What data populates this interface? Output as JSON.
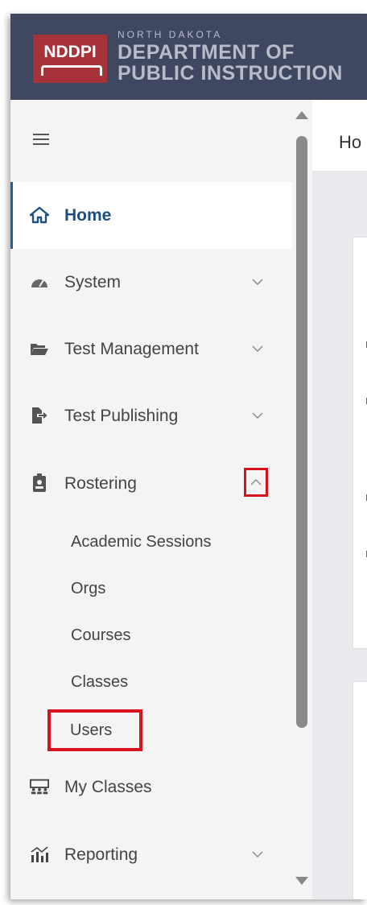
{
  "header": {
    "badge": "NDDPI",
    "org_small": "NORTH DAKOTA",
    "org_line1": "DEPARTMENT OF",
    "org_line2": "PUBLIC INSTRUCTION"
  },
  "sidebar": {
    "items": [
      {
        "label": "Home",
        "icon": "home-icon"
      },
      {
        "label": "System",
        "icon": "gauge-icon"
      },
      {
        "label": "Test Management",
        "icon": "folder-icon"
      },
      {
        "label": "Test Publishing",
        "icon": "file-export-icon"
      },
      {
        "label": "Rostering",
        "icon": "id-badge-icon"
      },
      {
        "label": "My Classes",
        "icon": "classroom-icon"
      },
      {
        "label": "Reporting",
        "icon": "chart-icon"
      }
    ],
    "rostering_sub": [
      "Academic Sessions",
      "Orgs",
      "Courses",
      "Classes",
      "Users"
    ]
  },
  "content": {
    "title": "Ho"
  },
  "colors": {
    "header_bg": "#3f4860",
    "badge_red": "#a8323a",
    "active_accent": "#1e4f80",
    "highlight_red": "#d6121d"
  }
}
